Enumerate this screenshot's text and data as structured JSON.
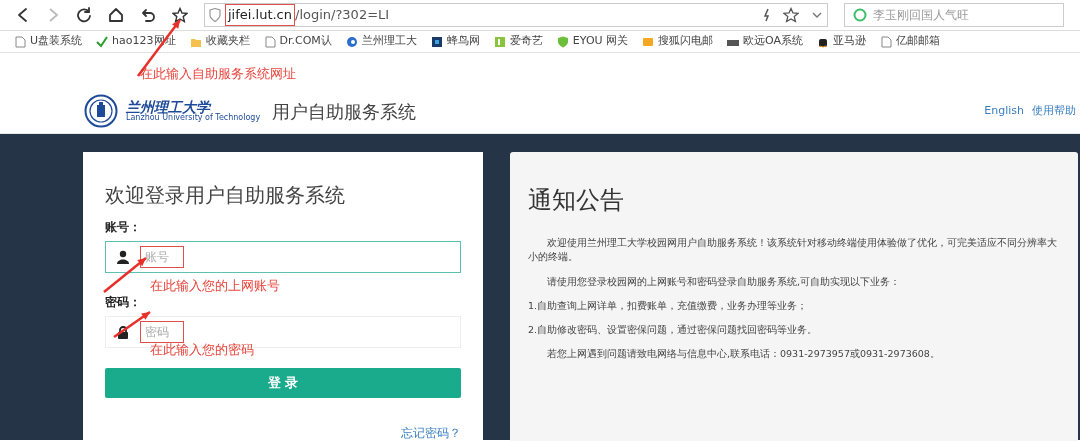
{
  "browser": {
    "address": {
      "domain": "jifei.lut.cn",
      "path": "/login/?302=LI",
      "highlighted": true
    },
    "search": {
      "placeholder": "李玉刚回国人气旺"
    },
    "bookmarks": [
      {
        "label": "U盘装系统",
        "kind": "page"
      },
      {
        "label": "hao123网址",
        "kind": "check"
      },
      {
        "label": "收藏夹栏",
        "kind": "folder"
      },
      {
        "label": "Dr.COM认",
        "kind": "page"
      },
      {
        "label": "兰州理工大",
        "kind": "swirl"
      },
      {
        "label": "蜂鸟网",
        "kind": "square"
      },
      {
        "label": "爱奇艺",
        "kind": "leaf"
      },
      {
        "label": "EYOU 网关",
        "kind": "shield"
      },
      {
        "label": "搜狐闪电邮",
        "kind": "mail"
      },
      {
        "label": "欧远OA系统",
        "kind": "logo"
      },
      {
        "label": "亚马逊",
        "kind": "bag"
      },
      {
        "label": "亿邮邮箱",
        "kind": "page"
      }
    ]
  },
  "annotations": [
    "在此输入自助服务系统网址",
    "在此输入您的上网账号",
    "在此输入您的密码"
  ],
  "site_header": {
    "logo_name": "兰州理工大学",
    "logo_subtitle": "Lanzhou University of Technology",
    "title": "用户自助服务系统",
    "links": [
      "English",
      "使用帮助"
    ]
  },
  "login": {
    "heading": "欢迎登录用户自助服务系统",
    "fields": [
      {
        "label": "账号：",
        "placeholder": "账号",
        "kind": "user",
        "focused": true,
        "highlighted": true
      },
      {
        "label": "密码：",
        "placeholder": "密码",
        "kind": "lock",
        "focused": false,
        "highlighted": true
      }
    ],
    "submit": "登 录",
    "forgot": "忘记密码？"
  },
  "notice": {
    "title": "通知公告",
    "paragraphs": [
      {
        "text": "欢迎使用兰州理工大学校园网用户自助服务系统！该系统针对移动终端使用体验做了优化，可完美适应不同分辨率大小的终端。",
        "indent": true
      },
      {
        "text": "请使用您登录校园网的上网账号和密码登录自助服务系统,可自助实现以下业务：",
        "indent": true
      },
      {
        "text": "1.自助查询上网详单，扣费账单，充值缴费，业务办理等业务；",
        "indent": false
      },
      {
        "text": "2.自助修改密码、设置密保问题，通过密保问题找回密码等业务。",
        "indent": false
      },
      {
        "text": "若您上网遇到问题请致电网络与信息中心,联系电话：0931-2973957或0931-2973608。",
        "indent": true
      }
    ]
  }
}
